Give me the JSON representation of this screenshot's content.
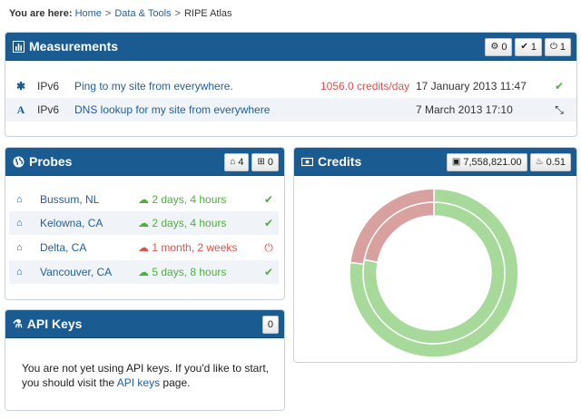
{
  "breadcrumb": {
    "label": "You are here:",
    "items": [
      "Home",
      "Data & Tools",
      "RIPE Atlas"
    ],
    "separator": ">"
  },
  "measurements": {
    "title": "Measurements",
    "buttons": [
      {
        "icon": "gear-icon",
        "glyph": "⚙",
        "count": "0"
      },
      {
        "icon": "check-icon",
        "glyph": "✔",
        "count": "1"
      },
      {
        "icon": "power-icon",
        "glyph": "⏻",
        "count": "1"
      }
    ],
    "rows": [
      {
        "icon": "asterisk-icon",
        "glyph": "✱",
        "type": "IPv6",
        "description": "Ping to my site from everywhere.",
        "credits": "1056.0 credits/day",
        "date": "17 January 2013 11:47",
        "status_icon": "check-icon",
        "status_glyph": "✔"
      },
      {
        "icon": "dns-icon",
        "glyph": "A",
        "type": "IPv6",
        "description": "DNS lookup for my site from everywhere",
        "credits": "",
        "date": "7 March 2013 17:10",
        "status_icon": "collapse-icon",
        "status_glyph": "⤡"
      }
    ]
  },
  "probes": {
    "title": "Probes",
    "buttons": [
      {
        "icon": "home-icon",
        "glyph": "⌂",
        "count": "4"
      },
      {
        "icon": "gift-icon",
        "glyph": "⊞",
        "count": "0"
      }
    ],
    "rows": [
      {
        "name": "Bussum, NL",
        "uptime": "2 days, 4 hours",
        "state": "up"
      },
      {
        "name": "Kelowna, CA",
        "uptime": "2 days, 4 hours",
        "state": "up"
      },
      {
        "name": "Delta, CA",
        "uptime": "1 month, 2 weeks",
        "state": "down"
      },
      {
        "name": "Vancouver, CA",
        "uptime": "5 days, 8 hours",
        "state": "up"
      }
    ]
  },
  "credits": {
    "title": "Credits",
    "balance": "7,558,821.00",
    "rate": "0.51",
    "donut_outer": {
      "green": 0.77,
      "red": 0.23
    },
    "donut_inner": {
      "green": 0.78,
      "red": 0.22
    },
    "colors": {
      "green": "#a6d99a",
      "red": "#d9a0a0",
      "stroke": "#ffffff"
    }
  },
  "api_keys": {
    "title": "API Keys",
    "count": "0",
    "text_before": "You are not yet using API keys. If you'd like to start, you should visit the ",
    "link": "API keys",
    "text_after": " page."
  },
  "colors": {
    "header": "#1a5b92",
    "link": "#1f5f99",
    "ok": "#4fae3f",
    "error": "#d9534f"
  }
}
